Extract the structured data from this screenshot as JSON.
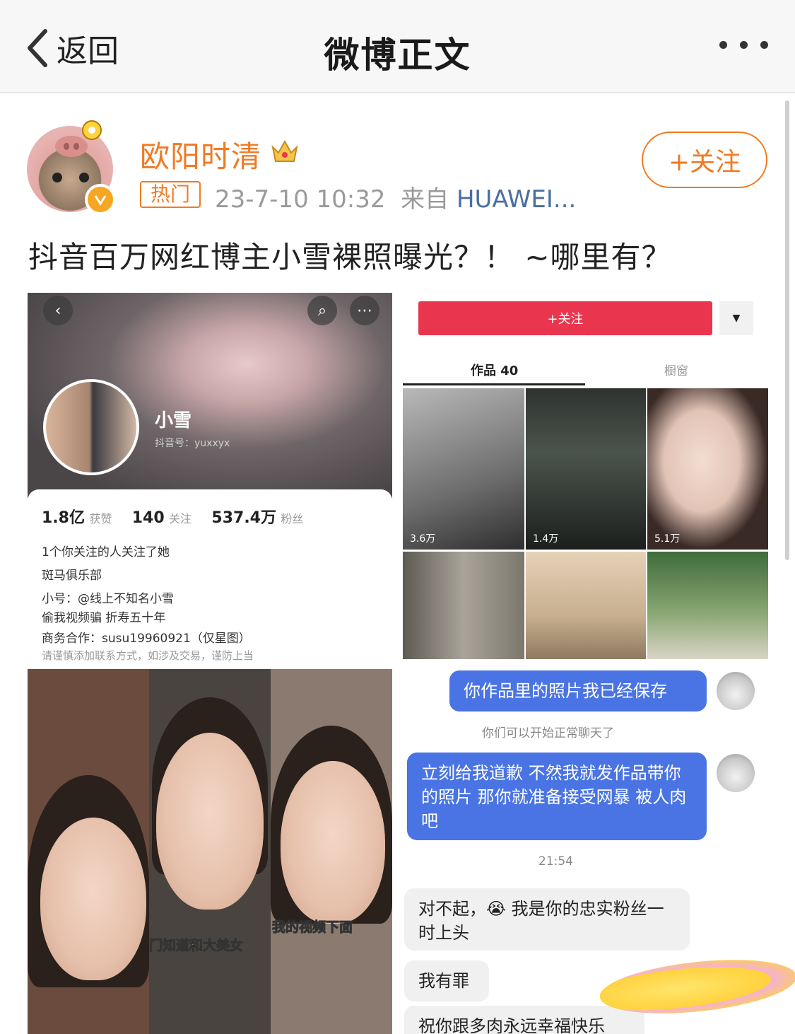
{
  "header": {
    "back_label": "返回",
    "title": "微博正文"
  },
  "post": {
    "author": "欧阳时清",
    "hot_tag": "热门",
    "timestamp": "23-7-10 10:32",
    "source_prefix": "来自",
    "source": "HUAWEI...",
    "follow_label": "+关注",
    "text": "抖音百万网红博主小雪裸照曝光？！ ~哪里有？"
  },
  "profile_shot": {
    "name": "小雪",
    "account_id": "抖音号：yuxxyx",
    "stats": [
      {
        "value": "1.8亿",
        "label": "获赞"
      },
      {
        "value": "140",
        "label": "关注"
      },
      {
        "value": "537.4万",
        "label": "粉丝"
      }
    ],
    "lines": [
      "1个你关注的人关注了她",
      "斑马俱乐部",
      "小号：@线上不知名小雪",
      "偷我视频骗 折寿五十年",
      "商务合作：susu19960921（仅星图）",
      "请谨慎添加联系方式，如涉及交易，谨防上当"
    ]
  },
  "works_shot": {
    "follow_label": "+关注",
    "tab_works": "作品 40",
    "tab_window": "橱窗",
    "likes": [
      "3.6万",
      "1.4万",
      "5.1万"
    ]
  },
  "selfie_shot": {
    "caption_1": "门知道和大美女",
    "caption_2": "我的视频下面"
  },
  "chat_shot": {
    "msg_1": "你作品里的照片我已经保存",
    "system": "你们可以开始正常聊天了",
    "msg_2": "立刻给我道歉 不然我就发作品带你的照片 那你就准备接受网暴 被人肉吧",
    "time": "21:54",
    "reply_1": "对不起，😭 我是你的忠实粉丝一时上头",
    "reply_2": "我有罪",
    "reply_3": "祝你跟多肉永远幸福快乐"
  },
  "colors": {
    "accent": "#f07a22",
    "link": "#4a6fa0",
    "chat_blue": "#4a74e3",
    "douyin_red": "#e9364e"
  }
}
